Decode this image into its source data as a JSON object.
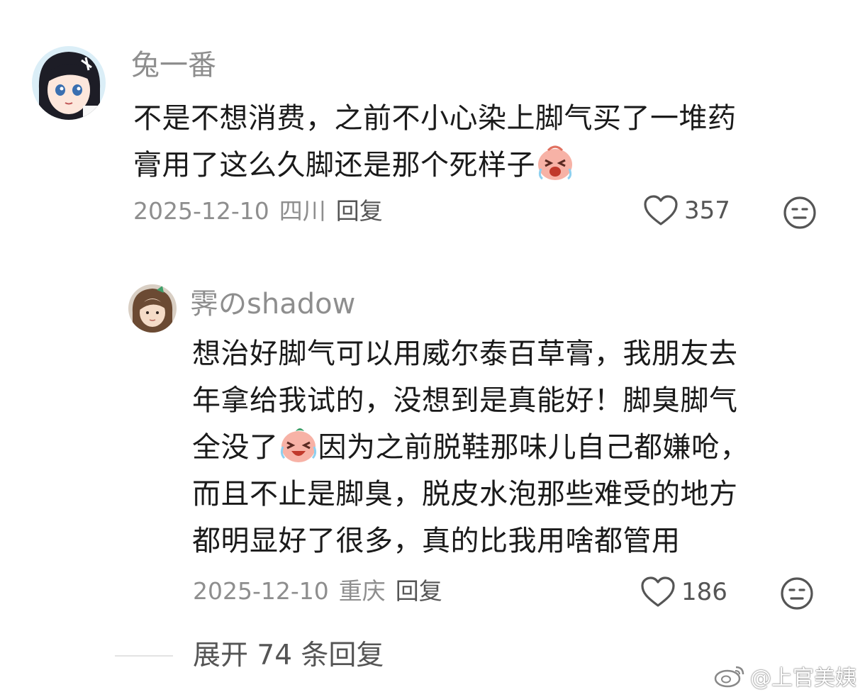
{
  "comment": {
    "username": "兔一番",
    "text_lines": [
      "不是不想消费，之前不小心染上脚气买了一堆药",
      "膏用了这么久脚还是那个死样子"
    ],
    "date": "2025-12-10",
    "location": "四川",
    "reply_label": "回复",
    "likes": "357"
  },
  "reply": {
    "username": "霁のshadow",
    "text_lines": [
      "想治好脚气可以用威尔泰百草膏，我朋友去",
      "年拿给我试的，没想到是真能好！脚臭脚气",
      "全没了",
      "因为之前脱鞋那味儿自己都嫌呛，",
      "而且不止是脚臭，脱皮水泡那些难受的地方",
      "都明显好了很多，真的比我用啥都管用"
    ],
    "date": "2025-12-10",
    "location": "重庆",
    "reply_label": "回复",
    "likes": "186"
  },
  "expand_label": "展开 74 条回复",
  "watermark": "@上官美姨",
  "colors": {
    "text_primary": "#1a1a1a",
    "text_secondary": "#8e8e8e",
    "icon": "#555555"
  }
}
